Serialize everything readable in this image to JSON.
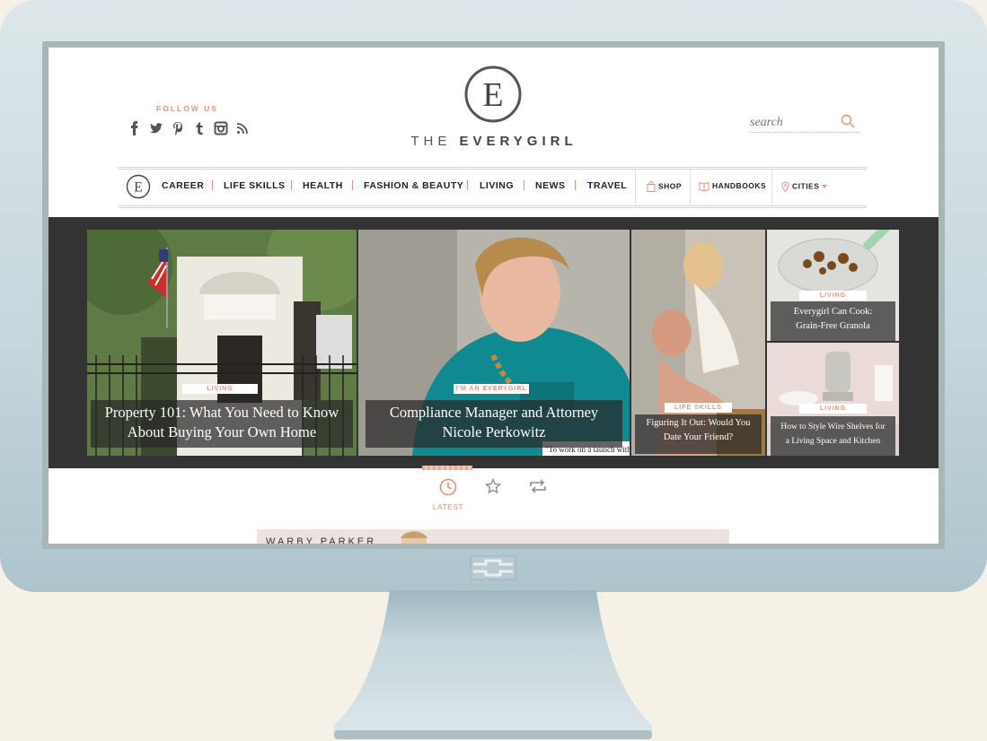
{
  "header": {
    "follow_label": "FOLLOW US",
    "social_icons": [
      "facebook-icon",
      "twitter-icon",
      "pinterest-icon",
      "tumblr-icon",
      "instagram-icon",
      "rss-icon"
    ],
    "logo_letter": "E",
    "brand_prefix": "THE",
    "brand_name": "EVERYGIRL",
    "search_placeholder": "search"
  },
  "nav": {
    "items": [
      "CAREER",
      "LIFE SKILLS",
      "HEALTH",
      "FASHION & BEAUTY",
      "LIVING",
      "NEWS",
      "TRAVEL"
    ],
    "shop": "SHOP",
    "handbooks": "HANDBOOKS",
    "cities": "CITIES"
  },
  "hero": {
    "tiles": [
      {
        "tag": "LIVING",
        "title_line1": "Property 101: What You Need to Know",
        "title_line2": "About Buying Your Own Home"
      },
      {
        "tag": "I'M AN EVERYGIRL",
        "title_line1": "Compliance Manager and Attorney",
        "title_line2": "Nicole Perkowitz",
        "quote": "\"To work on a launch with a"
      },
      {
        "tag": "LIFE SKILLS",
        "title_line1": "Figuring It Out: Would You",
        "title_line2": "Date Your Friend?"
      },
      {
        "tag": "LIVING",
        "title_line1": "Everygirl Can Cook:",
        "title_line2": "Grain-Free Granola"
      },
      {
        "tag": "LIVING",
        "title_line1": "How to Style Wire Shelves for",
        "title_line2": "a Living Space and Kitchen"
      }
    ]
  },
  "tabs": {
    "latest": "LATEST"
  },
  "ad": {
    "text": "WARBY PARKER"
  },
  "colors": {
    "accent": "#e8907a",
    "monitor": "#c7d7dd",
    "background": "#f6f1e6"
  }
}
